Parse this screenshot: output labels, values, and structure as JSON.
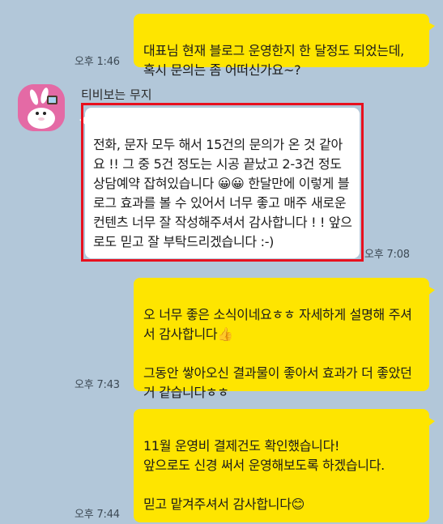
{
  "messages": {
    "m1": {
      "text": "대표님 현재 블로그 운영한지 한 달정도 되었는데, 혹시 문의는 좀 어떠신가요~?",
      "time": "오후 1:46"
    },
    "m2": {
      "sender": "티비보는 무지",
      "text": "전화, 문자 모두 해서 15건의 문의가 온 것 같아요 !! 그 중 5건 정도는 시공 끝났고 2-3건 정도 상담예약 잡혀있습니다 😀😀 한달만에 이렇게 블로그 효과를 볼 수 있어서 너무 좋고 매주 새로운 컨텐츠 너무 잘 작성해주셔서 감사합니다 ! ! 앞으로도 믿고 잘 부탁드리겠습니다 :-)",
      "time": "오후 7:08"
    },
    "m3": {
      "text": "오 너무 좋은 소식이네요ㅎㅎ 자세하게 설명해 주셔서 감사합니다👍\n\n그동안 쌓아오신 결과물이 좋아서 효과가 더 좋았던거 같습니다ㅎㅎ",
      "time": "오후 7:43"
    },
    "m4": {
      "text": "11월 운영비 결제건도 확인했습니다!\n앞으로도 신경 써서 운영해보도록 하겠습니다.\n\n믿고 맡겨주셔서 감사합니다😊",
      "time": "오후 7:44"
    }
  },
  "colors": {
    "background": "#b2c7d9",
    "my_bubble": "#fee500",
    "their_bubble": "#ffffff",
    "highlight_border": "#e8101e"
  },
  "icons": {
    "avatar": "muzi-avatar-icon"
  }
}
